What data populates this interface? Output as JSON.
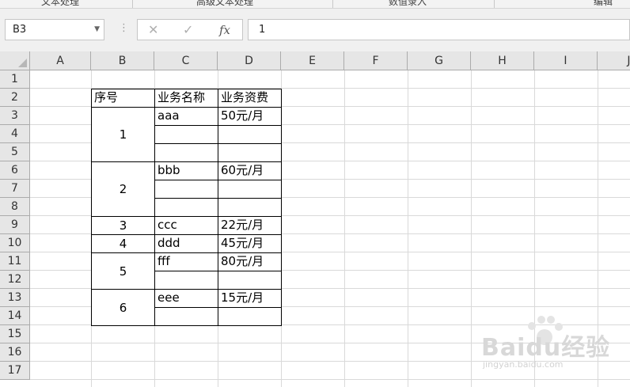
{
  "ribbon": {
    "groups": [
      "文本处理",
      "高级文本处理",
      "数值录入",
      "编辑"
    ]
  },
  "formula_bar": {
    "name_box": "B3",
    "formula": "1",
    "fx_label": "fx"
  },
  "columns": [
    "A",
    "B",
    "C",
    "D",
    "E",
    "F",
    "G",
    "H",
    "I",
    "J"
  ],
  "rows": [
    "1",
    "2",
    "3",
    "4",
    "5",
    "6",
    "7",
    "8",
    "9",
    "10",
    "11",
    "12",
    "13",
    "14",
    "15",
    "16",
    "17"
  ],
  "table": {
    "headers": {
      "seq": "序号",
      "name": "业务名称",
      "fee": "业务资费"
    },
    "groups": [
      {
        "seq": "1",
        "rows": [
          {
            "name": "aaa",
            "fee": "50元/月"
          },
          {
            "name": "",
            "fee": ""
          },
          {
            "name": "",
            "fee": ""
          }
        ]
      },
      {
        "seq": "2",
        "rows": [
          {
            "name": "bbb",
            "fee": "60元/月"
          },
          {
            "name": "",
            "fee": ""
          },
          {
            "name": "",
            "fee": ""
          }
        ]
      },
      {
        "seq": "3",
        "rows": [
          {
            "name": "ccc",
            "fee": "22元/月"
          }
        ]
      },
      {
        "seq": "4",
        "rows": [
          {
            "name": "ddd",
            "fee": "45元/月"
          }
        ]
      },
      {
        "seq": "5",
        "rows": [
          {
            "name": "fff",
            "fee": "80元/月"
          },
          {
            "name": "",
            "fee": ""
          }
        ]
      },
      {
        "seq": "6",
        "rows": [
          {
            "name": "eee",
            "fee": "15元/月"
          },
          {
            "name": "",
            "fee": ""
          }
        ]
      }
    ]
  },
  "watermark": {
    "main": "Baidu经验",
    "sub": "jingyan.baidu.com"
  }
}
